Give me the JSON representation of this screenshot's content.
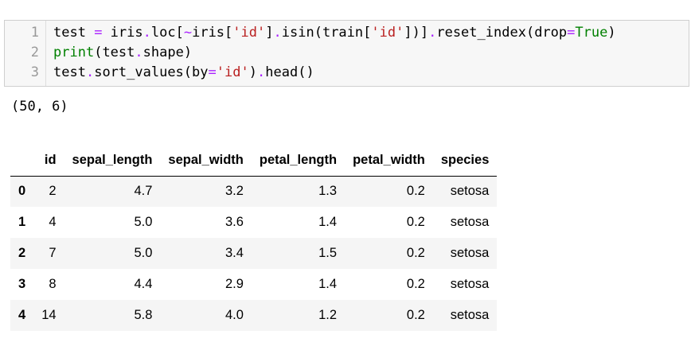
{
  "code_cell": {
    "line_numbers": [
      "1",
      "2",
      "3"
    ],
    "lines": [
      "test = iris.loc[~iris['id'].isin(train['id'])].reset_index(drop=True)",
      "print(test.shape)",
      "test.sort_values(by='id').head()"
    ]
  },
  "output": {
    "printed": "(50, 6)"
  },
  "dataframe": {
    "columns": [
      "",
      "id",
      "sepal_length",
      "sepal_width",
      "petal_length",
      "petal_width",
      "species"
    ],
    "rows": [
      [
        "0",
        "2",
        "4.7",
        "3.2",
        "1.3",
        "0.2",
        "setosa"
      ],
      [
        "1",
        "4",
        "5.0",
        "3.6",
        "1.4",
        "0.2",
        "setosa"
      ],
      [
        "2",
        "7",
        "5.0",
        "3.4",
        "1.5",
        "0.2",
        "setosa"
      ],
      [
        "3",
        "8",
        "4.4",
        "2.9",
        "1.4",
        "0.2",
        "setosa"
      ],
      [
        "4",
        "14",
        "5.8",
        "4.0",
        "1.2",
        "0.2",
        "setosa"
      ]
    ]
  }
}
